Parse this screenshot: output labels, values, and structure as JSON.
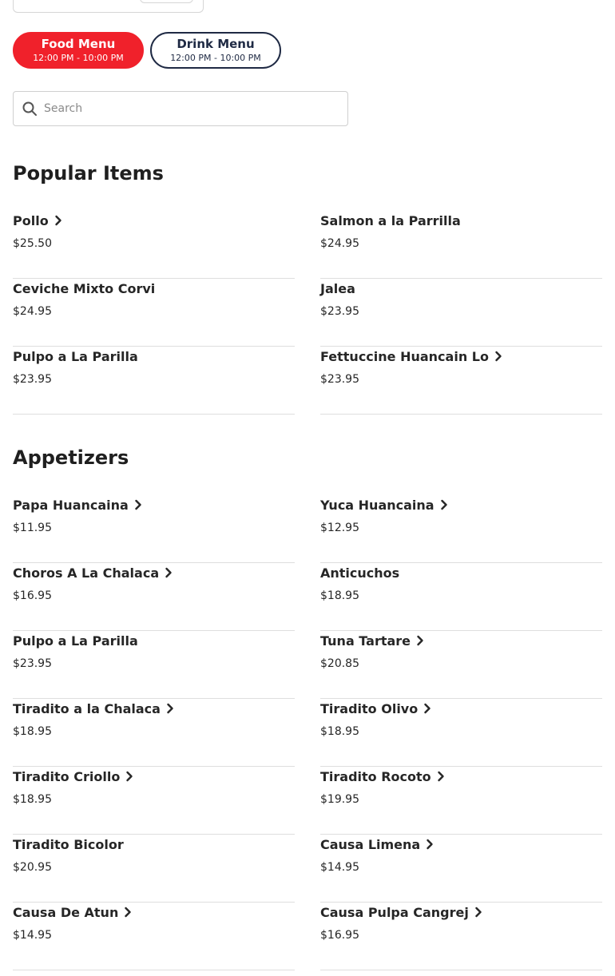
{
  "menus": [
    {
      "title": "Food Menu",
      "hours": "12:00 PM - 10:00 PM",
      "active": true
    },
    {
      "title": "Drink Menu",
      "hours": "12:00 PM - 10:00 PM",
      "active": false
    }
  ],
  "search": {
    "placeholder": "Search"
  },
  "colors": {
    "accent": "#f0212b",
    "navy": "#1f2a44"
  },
  "sections": [
    {
      "title": "Popular Items",
      "items": [
        {
          "name": "Pollo",
          "price": "$25.50",
          "chevron": true
        },
        {
          "name": "Salmon a la Parrilla",
          "price": "$24.95",
          "chevron": false
        },
        {
          "name": "Ceviche Mixto Corvi",
          "price": "$24.95",
          "chevron": false
        },
        {
          "name": "Jalea",
          "price": "$23.95",
          "chevron": false
        },
        {
          "name": "Pulpo a La Parilla",
          "price": "$23.95",
          "chevron": false
        },
        {
          "name": "Fettuccine Huancain Lo",
          "price": "$23.95",
          "chevron": true
        }
      ]
    },
    {
      "title": "Appetizers",
      "items": [
        {
          "name": "Papa Huancaina",
          "price": "$11.95",
          "chevron": true
        },
        {
          "name": "Yuca Huancaina",
          "price": "$12.95",
          "chevron": true
        },
        {
          "name": "Choros A La Chalaca",
          "price": "$16.95",
          "chevron": true
        },
        {
          "name": "Anticuchos",
          "price": "$18.95",
          "chevron": false
        },
        {
          "name": "Pulpo a La Parilla",
          "price": "$23.95",
          "chevron": false
        },
        {
          "name": "Tuna Tartare",
          "price": "$20.85",
          "chevron": true
        },
        {
          "name": "Tiradito a la Chalaca",
          "price": "$18.95",
          "chevron": true
        },
        {
          "name": "Tiradito Olivo",
          "price": "$18.95",
          "chevron": true
        },
        {
          "name": "Tiradito Criollo",
          "price": "$18.95",
          "chevron": true
        },
        {
          "name": "Tiradito Rocoto",
          "price": "$19.95",
          "chevron": true
        },
        {
          "name": "Tiradito Bicolor",
          "price": "$20.95",
          "chevron": false
        },
        {
          "name": "Causa Limena",
          "price": "$14.95",
          "chevron": true
        },
        {
          "name": "Causa De Atun",
          "price": "$14.95",
          "chevron": true
        },
        {
          "name": "Causa Pulpa Cangrej",
          "price": "$16.95",
          "chevron": true
        }
      ]
    }
  ]
}
